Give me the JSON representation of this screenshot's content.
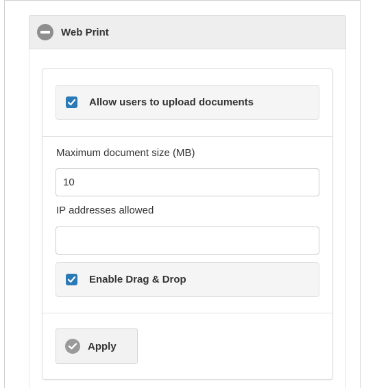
{
  "section": {
    "title": "Web Print",
    "collapse_icon": "minus-circle-icon"
  },
  "upload_option": {
    "label": "Allow users to upload documents",
    "checked": true
  },
  "max_size": {
    "label": "Maximum document size (MB)",
    "value": "10"
  },
  "ip_addresses": {
    "label": "IP addresses allowed",
    "value": ""
  },
  "drag_drop_option": {
    "label": "Enable Drag & Drop",
    "checked": true
  },
  "apply_button": {
    "label": "Apply",
    "icon": "check-circle-icon"
  },
  "colors": {
    "checkbox": "#2a7ab8",
    "header_bg": "#eeeeee",
    "option_bg": "#f5f5f5"
  }
}
